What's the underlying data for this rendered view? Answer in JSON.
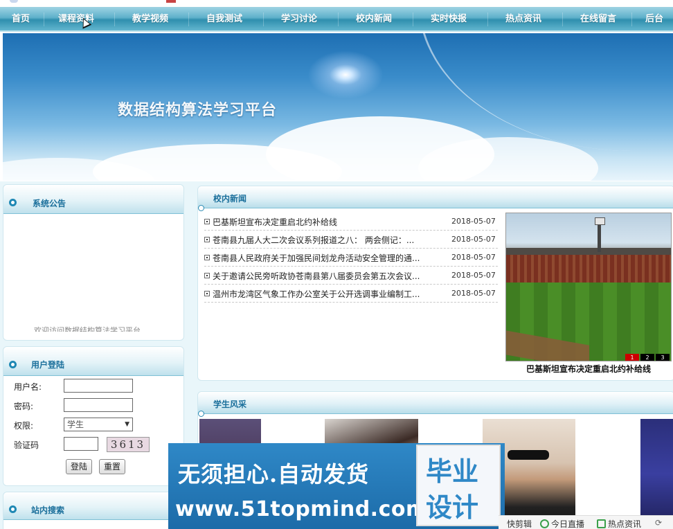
{
  "nav": {
    "items": [
      "首页",
      "课程资料",
      "教学视频",
      "自我测试",
      "学习讨论",
      "校内新闻",
      "实时快报",
      "热点资讯",
      "在线留言",
      "后台"
    ]
  },
  "banner": {
    "title": "数据结构算法学习平台"
  },
  "notice": {
    "title": "系统公告",
    "scroll_text": "欢迎访问数据结构算法学习平台"
  },
  "login": {
    "title": "用户登陆",
    "username_label": "用户名:",
    "password_label": "密码:",
    "role_label": "权限:",
    "role_value": "学生",
    "captcha_label": "验证码",
    "captcha_value": "3613",
    "login_button": "登陆",
    "reset_button": "重置"
  },
  "search": {
    "title": "站内搜索"
  },
  "news": {
    "title": "校内新闻",
    "items": [
      {
        "title": "巴基斯坦宣布决定重启北约补给线",
        "date": "2018-05-07"
      },
      {
        "title": "苍南县九届人大二次会议系列报道之八： 两会侧记：...",
        "date": "2018-05-07"
      },
      {
        "title": "苍南县人民政府关于加强民间划龙舟活动安全管理的通...",
        "date": "2018-05-07"
      },
      {
        "title": "关于邀请公民旁听政协苍南县第八届委员会第五次会议...",
        "date": "2018-05-07"
      },
      {
        "title": "温州市龙湾区气象工作办公室关于公开选调事业编制工...",
        "date": "2018-05-07"
      }
    ],
    "photo_caption": "巴基斯坦宣布决定重启北约补给线",
    "pager": [
      "1",
      "2",
      "3"
    ]
  },
  "students": {
    "title": "学生风采"
  },
  "ad": {
    "slogan": "无须担心.自动发货",
    "url": "www.51topmind.com",
    "box_line1": "毕业",
    "box_line2": "设计"
  },
  "statusbar": {
    "items": [
      "快剪辑",
      "今日直播",
      "热点资讯"
    ]
  },
  "colors": {
    "nav_dark": "#2f8fae",
    "nav_light": "#9fd3e3",
    "panel_title": "#1a6f9b",
    "pager_active": "#cc0000",
    "ad_blue": "#2f88c7"
  }
}
